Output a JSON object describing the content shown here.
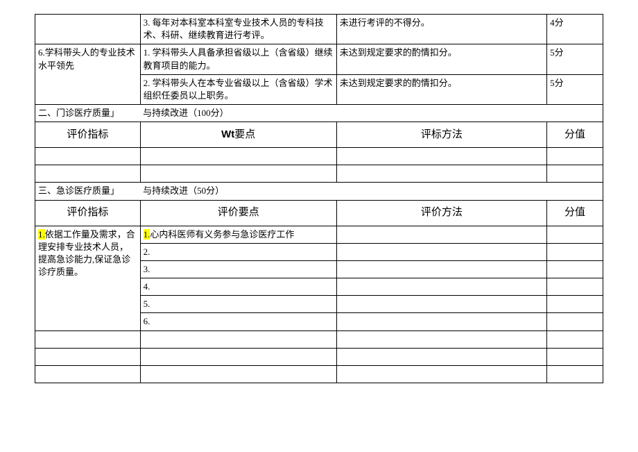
{
  "top_table": {
    "row1": {
      "points": "3. 每年对本科室本科室专业技术人员的专科技术、科研、继续教育进行考评。",
      "method": "未进行考评的不得分。",
      "score": "4分"
    },
    "row2": {
      "indicator": "6.学科带头人的专业技术水平领先",
      "points": "1. 学科带头人具备承担省级以上（含省级）继续教育项目的能力。",
      "method": "未达到规定要求的酌情扣分。",
      "score": "5分"
    },
    "row3": {
      "points": "2. 学科带头人在本专业省级以上（含省级）学术组织任委员以上职务。",
      "method": "未达到规定要求的酌情扣分。",
      "score": "5分"
    }
  },
  "section2": {
    "title_left": "二、门诊医疗质量」",
    "title_right": "与持续改进（100分）",
    "headers": {
      "indicator": "评价指标",
      "points_wt": "Wt",
      "points_suffix": "要点",
      "method": "评标方法",
      "score": "分值"
    }
  },
  "section3": {
    "title_left": "三、急诊医疗质量」",
    "title_right": "与持续改进（50分）",
    "headers": {
      "indicator": "评价指标",
      "points": "评价要点",
      "method": "评价方法",
      "score": "分值"
    },
    "row1": {
      "indicator_hl": "1.",
      "indicator_rest1": "依据工作量及需求，合",
      "indicator_rest2": "理安排专业技术人员，提高急诊能力,保证急诊诊疗质量。",
      "points_hl": "1.",
      "points_rest": "心内科医师有义务参与急诊医疗工作"
    },
    "row2": {
      "points": "2."
    },
    "row3": {
      "points": "3."
    },
    "row4": {
      "points": "4."
    },
    "row5": {
      "points": "5."
    },
    "row6": {
      "points": "6."
    }
  }
}
